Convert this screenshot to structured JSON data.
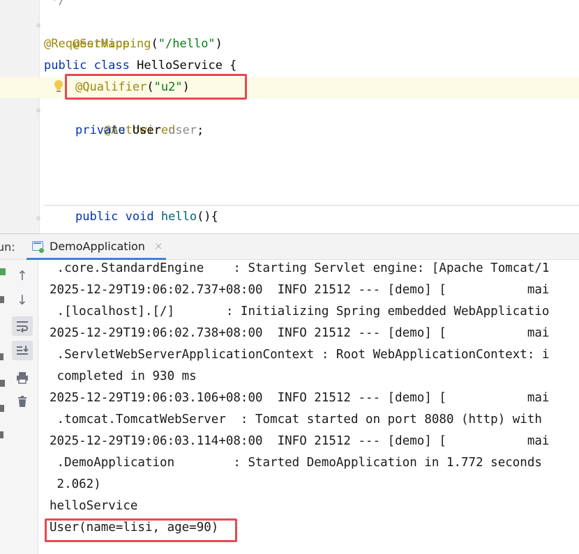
{
  "editor": {
    "lines": {
      "comment_end": " */",
      "service_annotation": "@Service",
      "request_mapping_annotation": "@RequestMapping",
      "request_mapping_open": "(",
      "request_mapping_value": "\"/hello\"",
      "request_mapping_close": ")",
      "kw_public": "public",
      "kw_class": "class",
      "class_name": "HelloService {",
      "qualifier_annotation": "@Qualifier",
      "qualifier_open": "(",
      "qualifier_value": "\"u2\"",
      "qualifier_close": ")",
      "autowired_annotation": "@Autowired",
      "kw_private": "private",
      "field_type": "User",
      "field_name": "user",
      "semicolon": ";",
      "kw_public2": "public",
      "kw_void": "void",
      "method_name": "hello",
      "method_sig_rest": "(){"
    }
  },
  "run_panel": {
    "label": "un:",
    "tab_title": "DemoApplication",
    "tab_close": "×"
  },
  "console": {
    "lines": [
      " .core.StandardEngine    : Starting Servlet engine: [Apache Tomcat/1",
      "2025-12-29T19:06:02.737+08:00  INFO 21512 --- [demo] [           mai",
      " .[localhost].[/]       : Initializing Spring embedded WebApplicatio",
      "2025-12-29T19:06:02.738+08:00  INFO 21512 --- [demo] [           mai",
      " .ServletWebServerApplicationContext : Root WebApplicationContext: i",
      " completed in 930 ms",
      "2025-12-29T19:06:03.106+08:00  INFO 21512 --- [demo] [           mai",
      " .tomcat.TomcatWebServer  : Tomcat started on port 8080 (http) with",
      "2025-12-29T19:06:03.114+08:00  INFO 21512 --- [demo] [           mai",
      " .DemoApplication        : Started DemoApplication in 1.772 seconds",
      " 2.062)",
      "helloService",
      "User(name=lisi, age=90)"
    ]
  },
  "colors": {
    "annotation": "#9e880d",
    "keyword": "#0033b3",
    "string": "#067d17",
    "highlight_box": "#e8484f"
  }
}
